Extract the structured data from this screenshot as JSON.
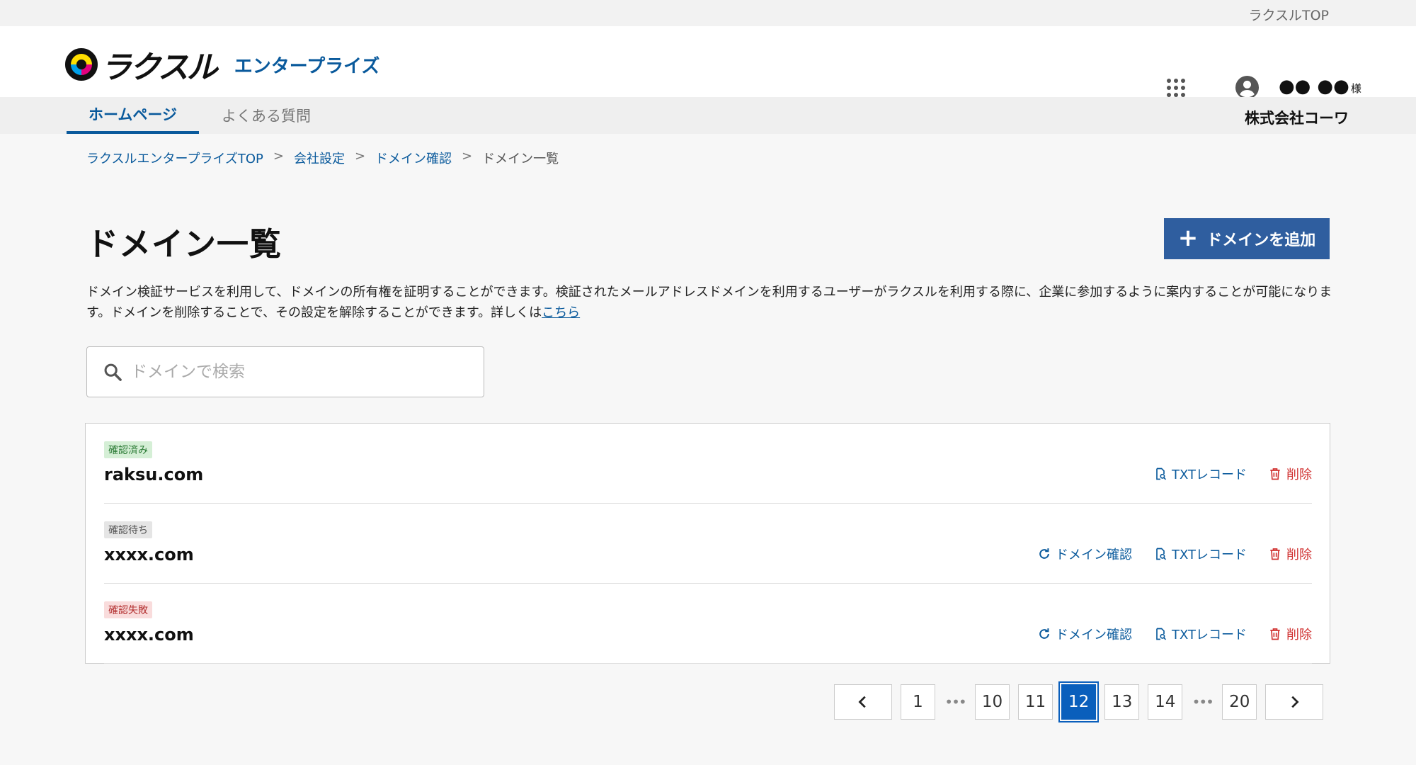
{
  "topbar": {
    "link": "ラクスルTOP"
  },
  "header": {
    "logo_word": "ラクスル",
    "logo_sub": "エンタープライズ",
    "user_name": "●● ●●",
    "user_suffix": "様"
  },
  "nav": {
    "tabs": [
      {
        "label": "ホームページ",
        "active": true
      },
      {
        "label": "よくある質問",
        "active": false
      }
    ],
    "company": "株式会社コーワ"
  },
  "breadcrumb": {
    "items": [
      "ラクスルエンタープライズTOP",
      "会社設定",
      "ドメイン確認"
    ],
    "separator": ">",
    "current": "ドメイン一覧"
  },
  "page": {
    "title": "ドメイン一覧",
    "add_button": "ドメインを追加",
    "description": "ドメイン検証サービスを利用して、ドメインの所有権を証明することができます。検証されたメールアドレスドメインを利用するユーザーがラクスルを利用する際に、企業に参加するように案内することが可能になります。ドメインを削除することで、その設定を解除することができます。詳しくは",
    "description_link": "こちら"
  },
  "search": {
    "placeholder": "ドメインで検索"
  },
  "actions": {
    "verify": "ドメイン確認",
    "txt": "TXTレコード",
    "delete": "削除"
  },
  "domains": [
    {
      "status": "確認済み",
      "name": "raksu.com"
    },
    {
      "status": "確認待ち",
      "name": "xxxx.com"
    },
    {
      "status": "確認失敗",
      "name": "xxxx.com"
    }
  ],
  "pagination": {
    "pages": [
      "1",
      "10",
      "11",
      "12",
      "13",
      "14",
      "20"
    ],
    "current": "12",
    "ellipsis": "•••"
  }
}
